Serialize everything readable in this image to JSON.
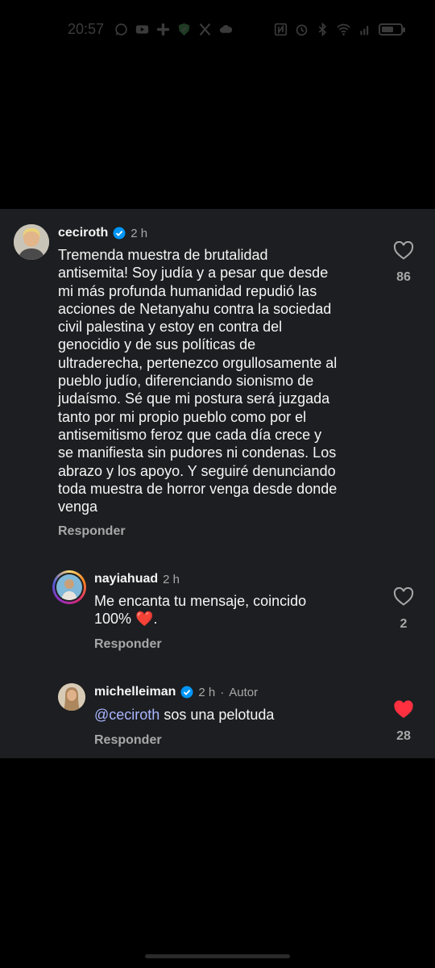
{
  "status_bar": {
    "time": "20:57",
    "left_icons": [
      "whatsapp-icon",
      "youtube-icon",
      "slack-icon",
      "shield-icon",
      "x-icon",
      "cloud-icon"
    ],
    "right_icons": [
      "nfc-icon",
      "alarm-icon",
      "bluetooth-icon",
      "wifi-icon",
      "sim-icon",
      "battery-icon"
    ]
  },
  "comments": [
    {
      "username": "ceciroth",
      "verified": true,
      "time": "2 h",
      "text_lines": [
        "Tremenda muestra de brutalidad",
        "antisemita! Soy judía y a pesar que desde",
        "mi más profunda humanidad repudió las",
        "acciones de Netanyahu contra la sociedad",
        "civil palestina y estoy en contra del",
        "genocidio y de sus políticas de",
        "ultraderecha, pertenezco orgullosamente al",
        "pueblo judío, diferenciando sionismo de",
        "judaísmo. Sé que mi postura será juzgada",
        "tanto por mi propio pueblo como por el",
        "antisemitismo feroz que cada día crece y",
        "se manifiesta sin pudores ni condenas. Los",
        "abrazo y los apoyo. Y seguiré denunciando",
        "toda muestra de horror venga desde donde",
        "venga"
      ],
      "reply_label": "Responder",
      "likes": "86",
      "liked": false
    },
    {
      "username": "nayiahuad",
      "verified": false,
      "time": "2 h",
      "text_line1": "Me encanta tu mensaje, coincido",
      "text_line2": "100%",
      "emoji": "❤️",
      "text_end": ".",
      "reply_label": "Responder",
      "likes": "2",
      "liked": false
    },
    {
      "username": "michelleiman",
      "verified": true,
      "time": "2 h",
      "separator": "·",
      "author_tag": "Autor",
      "mention": "@ceciroth",
      "text": "sos una pelotuda",
      "reply_label": "Responder",
      "likes": "28",
      "liked": true
    }
  ],
  "colors": {
    "panel_bg": "#1c1e21",
    "verified_blue": "#0095f6",
    "liked_red": "#ff3040",
    "mention": "#a9b6ff",
    "secondary_text": "#a8a8a8"
  }
}
